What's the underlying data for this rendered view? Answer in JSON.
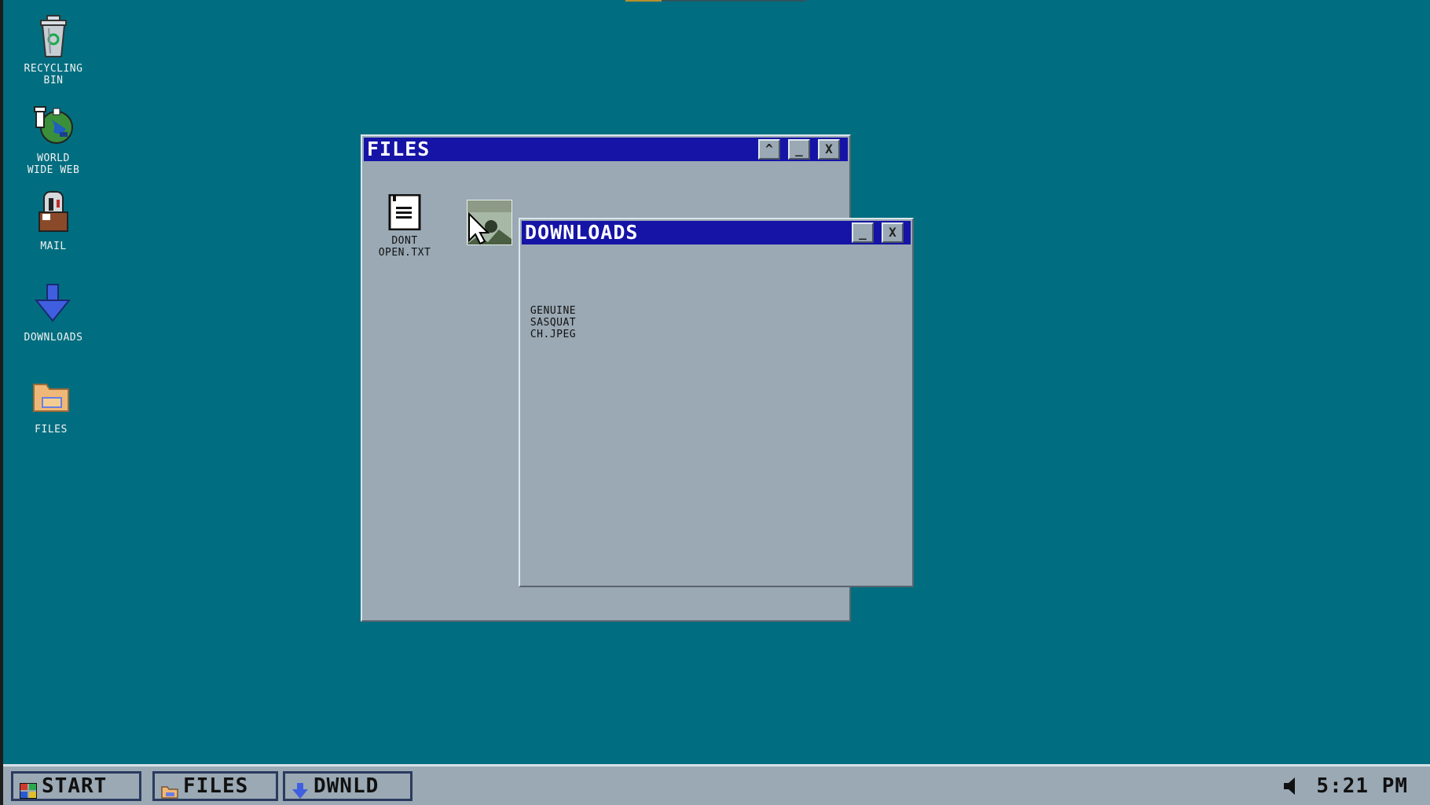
{
  "desktop": {
    "icons": [
      {
        "label": "RECYCLING\nBIN",
        "icon": "recycling-bin-icon"
      },
      {
        "label": "WORLD\nWIDE WEB",
        "icon": "globe-icon"
      },
      {
        "label": "MAIL",
        "icon": "mailbox-icon"
      },
      {
        "label": "DOWNLOADS",
        "icon": "download-arrow-icon"
      },
      {
        "label": "FILES",
        "icon": "folder-icon"
      }
    ]
  },
  "files_window": {
    "title": "FILES",
    "buttons": {
      "restore": "^",
      "minimize": "_",
      "close": "X"
    },
    "items": [
      {
        "label": "DONT\nOPEN.TXT",
        "icon": "text-file-icon"
      },
      {
        "label": "",
        "icon": "image-thumbnail-icon"
      }
    ]
  },
  "downloads_window": {
    "title": "DOWNLOADS",
    "buttons": {
      "minimize": "_",
      "close": "X"
    },
    "items": [
      {
        "label": "GENUINE\nSASQUAT\nCH.JPEG",
        "icon": "image-file-icon"
      }
    ]
  },
  "taskbar": {
    "start_label": "START",
    "tasks": [
      {
        "label": "FILES",
        "icon": "folder-icon"
      },
      {
        "label": "DWNLD",
        "icon": "download-arrow-icon"
      }
    ],
    "clock": "5:21 PM",
    "volume_icon": "speaker-icon"
  },
  "colors": {
    "desktop": "#006e80",
    "titlebar": "#1614a6",
    "window_body": "#9aa9b4"
  }
}
